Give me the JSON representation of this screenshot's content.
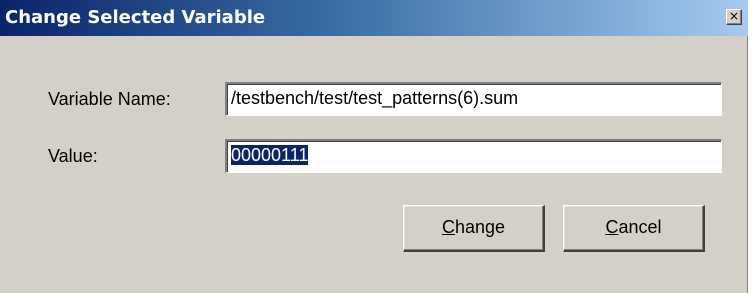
{
  "window": {
    "title": "Change Selected Variable",
    "close_glyph": "×"
  },
  "form": {
    "variable_name_label": "Variable Name:",
    "variable_name_value": "/testbench/test/test_patterns(6).sum",
    "value_label": "Value:",
    "value_value": "00000111"
  },
  "buttons": {
    "change": {
      "accel": "C",
      "rest": "hange"
    },
    "cancel": {
      "accel": "C",
      "rest": "ancel"
    }
  },
  "colors": {
    "dialog_bg": "#d4d0c8",
    "titlebar_start": "#0a246a",
    "titlebar_end": "#a6caf0",
    "selection_bg": "#0a246a"
  }
}
